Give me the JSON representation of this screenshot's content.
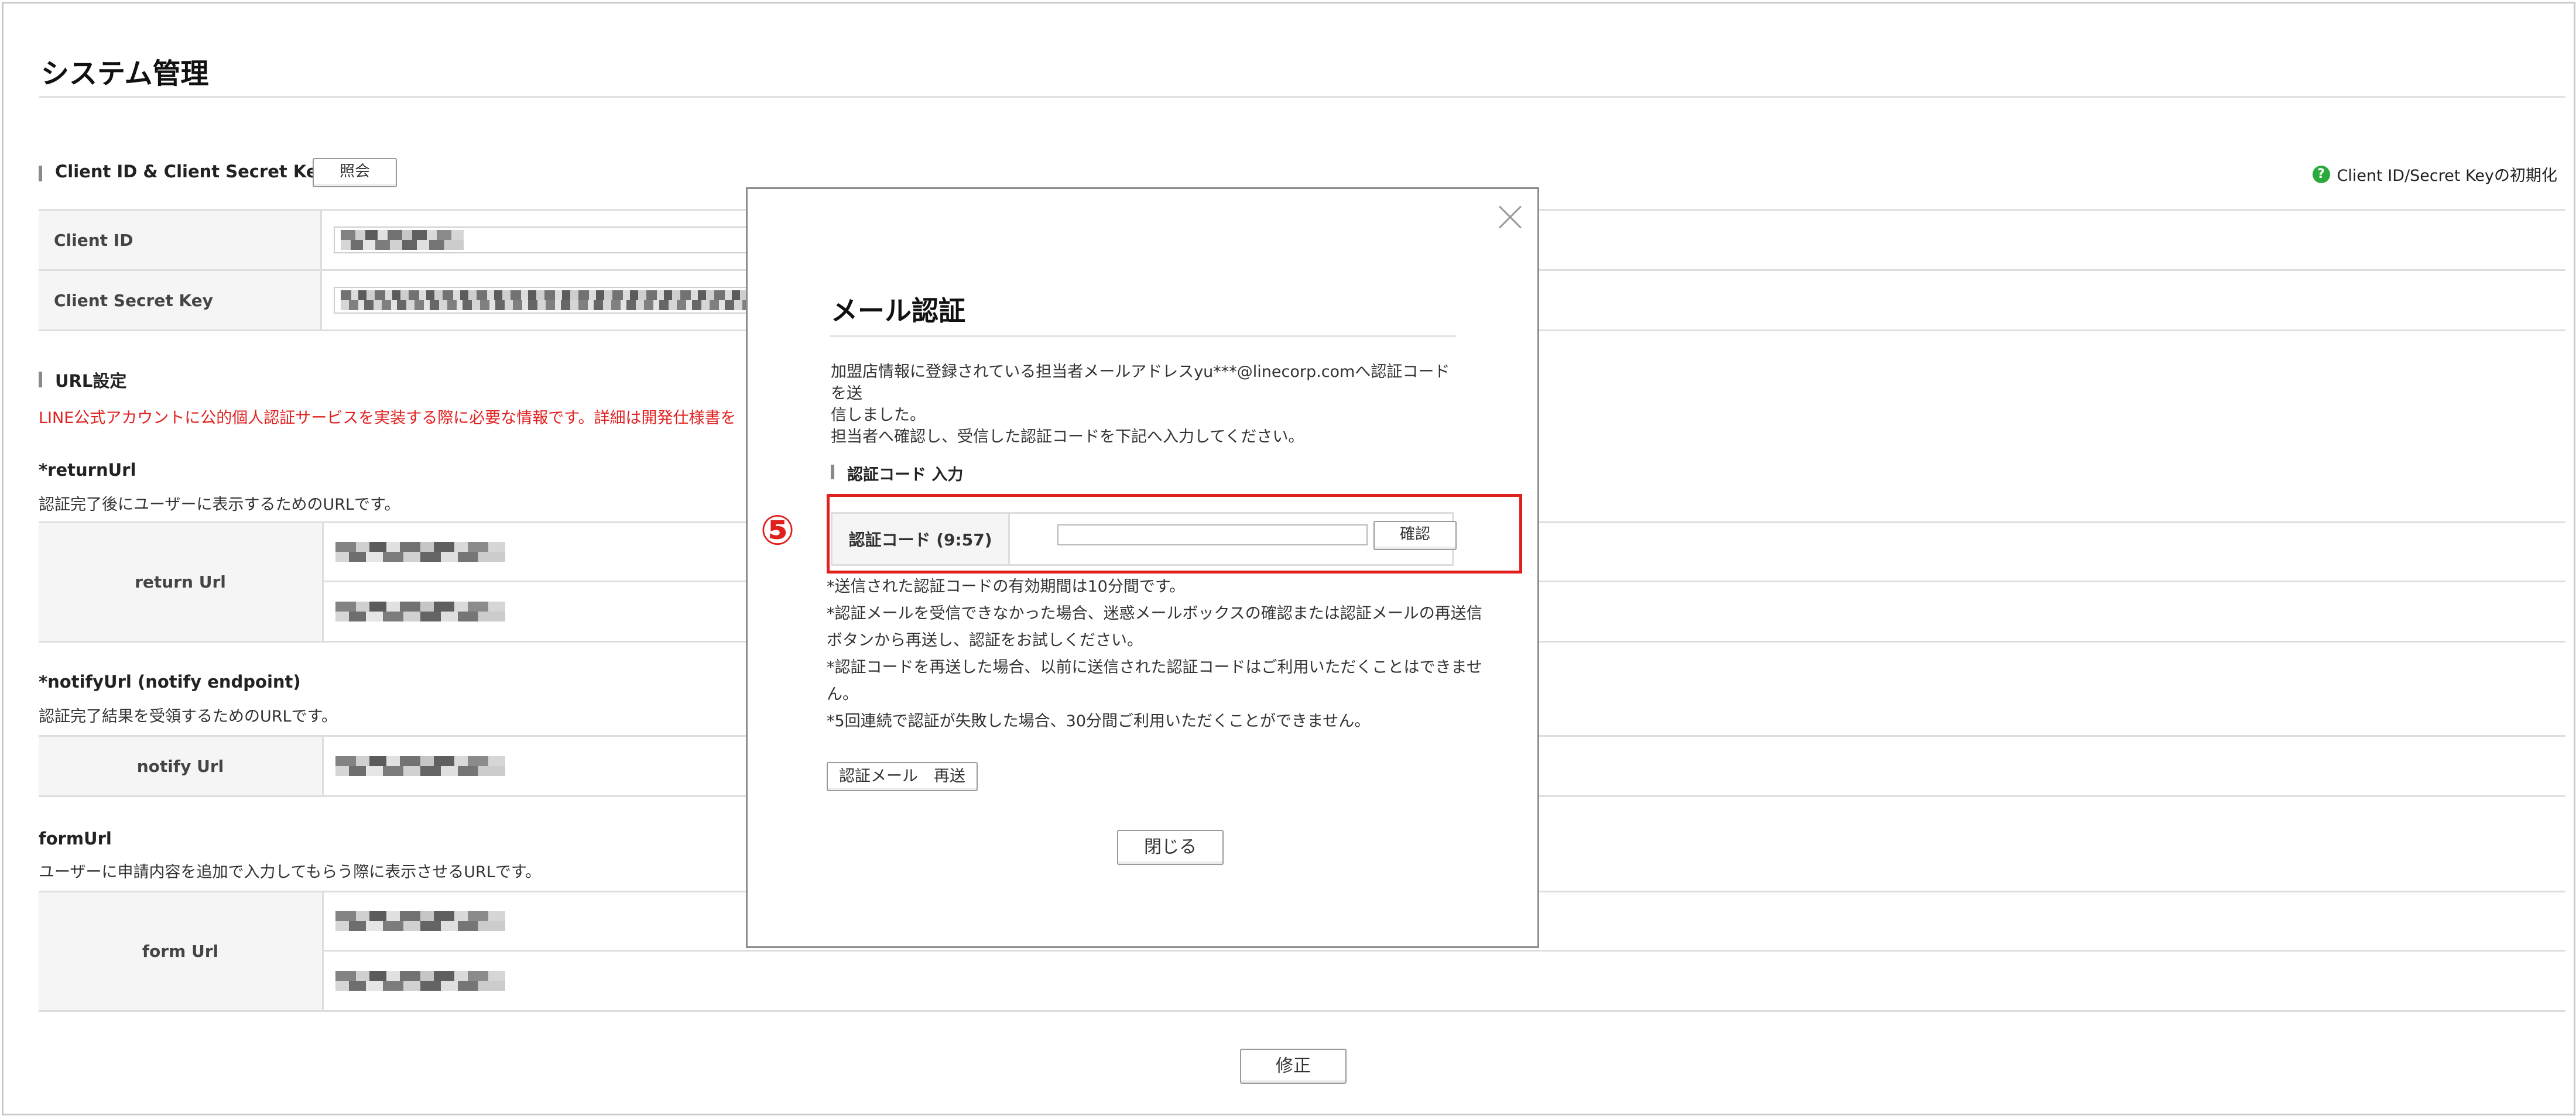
{
  "page": {
    "title": "システム管理"
  },
  "client_section": {
    "title": "Client ID & Client Secret Key",
    "inquiry_button": "照会",
    "reset_link": "Client ID/Secret Keyの初期化",
    "rows": [
      {
        "label": "Client ID"
      },
      {
        "label": "Client Secret Key"
      }
    ]
  },
  "url_section": {
    "title": "URL設定",
    "note": "LINE公式アカウントに公的個人認証サービスを実装する際に必要な情報です。詳細は開発仕様書を",
    "return": {
      "label": "*returnUrl",
      "desc": "認証完了後にユーザーに表示するためのURLです。",
      "row_label": "return Url"
    },
    "notify": {
      "label": "*notifyUrl (notify endpoint)",
      "desc": "認証完了結果を受領するためのURLです。",
      "row_label": "notify Url"
    },
    "form": {
      "label": "formUrl",
      "desc": "ユーザーに申請内容を追加で入力してもらう際に表示させるURLです。",
      "row_label": "form Url"
    },
    "modify_button": "修正"
  },
  "modal": {
    "title": "メール認証",
    "message_line1": "加盟店情報に登録されている担当者メールアドレスyu***@linecorp.comへ認証コードを送",
    "message_line2": "信しました。",
    "message_line3": "担当者へ確認し、受信した認証コードを下記へ入力してください。",
    "code_section_title": "認証コード 入力",
    "code_label": "認証コード (9:57)",
    "code_value": "",
    "confirm_button": "確認",
    "step_number": "⑤",
    "highlight_color": "#e0201c",
    "notes": [
      "*送信された認証コードの有効期間は10分間です。",
      "*認証メールを受信できなかった場合、迷惑メールボックスの確認または認証メールの再送信",
      "ボタンから再送し、認証をお試しください。",
      "*認証コードを再送した場合、以前に送信された認証コードはご利用いただくことはできませ",
      "ん。",
      "*5回連続で認証が失敗した場合、30分間ご利用いただくことができません。"
    ],
    "resend_button": "認証メール　再送",
    "close_button": "閉じる"
  },
  "icons": {
    "help": "help-circle-icon",
    "close": "close-icon"
  },
  "colors": {
    "alert_text": "#e02020",
    "help_icon": "#2aaa3c"
  }
}
